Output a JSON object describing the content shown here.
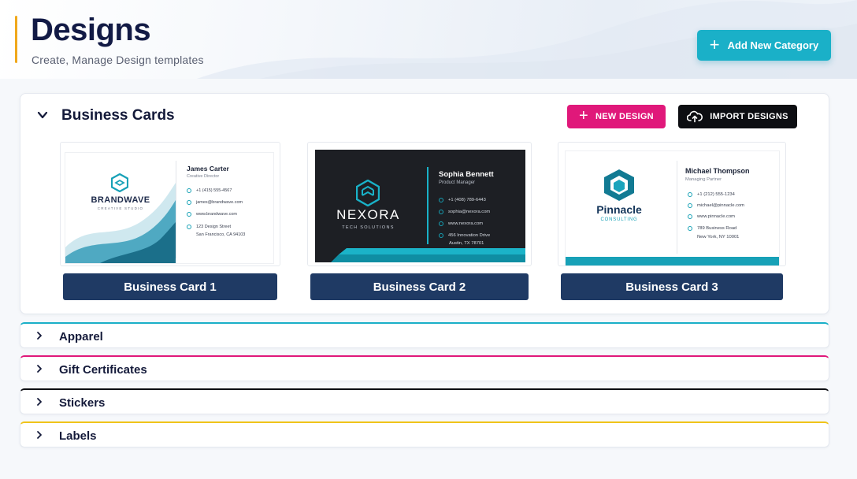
{
  "header": {
    "title": "Designs",
    "subtitle": "Create,  Manage  Design  templates",
    "add_category_label": "Add New Category"
  },
  "colors": {
    "teal": "#1ab0c8",
    "pink": "#e0187a",
    "black": "#0d0e12",
    "navy": "#1f3a64",
    "yellow": "#f0c419",
    "accent": "#f0a81c"
  },
  "business_cards": {
    "title": "Business Cards",
    "new_design_label": "NEW DESIGN",
    "import_label": "IMPORT DESIGNS",
    "cards": [
      {
        "label": "Business Card 1",
        "brand": "BRANDWAVE",
        "tagline": "CREATIVE STUDIO",
        "name": "James Carter",
        "role": "Creative Director",
        "phone": "+1 (415) 555-4567",
        "email": "james@brandwave.com",
        "web": "www.brandwave.com",
        "address1": "123 Design Street",
        "address2": "San Francisco, CA 94103"
      },
      {
        "label": "Business Card 2",
        "brand": "NEXORA",
        "tagline": "TECH SOLUTIONS",
        "name": "Sophia Bennett",
        "role": "Product Manager",
        "phone": "+1 (408) 789-6443",
        "email": "sophia@nexora.com",
        "web": "www.nexora.com",
        "address1": "456 Innovation Drive",
        "address2": "Austin, TX 78701"
      },
      {
        "label": "Business Card 3",
        "brand": "Pinnacle",
        "tagline": "CONSULTING",
        "name": "Michael Thompson",
        "role": "Managing Partner",
        "phone": "+1 (212) 555-1234",
        "email": "michael@pinnacle.com",
        "web": "www.pinnacle.com",
        "address1": "789 Business Road",
        "address2": "New York, NY 10001"
      }
    ]
  },
  "categories": [
    {
      "label": "Apparel",
      "color": "#1ab0c8"
    },
    {
      "label": "Gift Certificates",
      "color": "#e0187a"
    },
    {
      "label": "Stickers",
      "color": "#0d0e12"
    },
    {
      "label": "Labels",
      "color": "#f0c419"
    }
  ]
}
